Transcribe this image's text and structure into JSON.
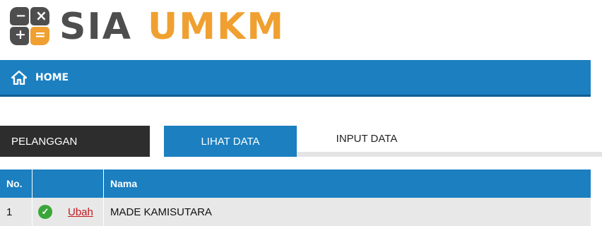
{
  "logo": {
    "text_sia": "SIA",
    "text_umkm": "UMKM",
    "colors": {
      "dark": "#4e4e4e",
      "accent": "#f0a030"
    },
    "calc_glyphs": [
      "−",
      "×",
      "+",
      "="
    ]
  },
  "nav": {
    "home_icon": "home-icon",
    "home_label": "HOME",
    "color": "#1b7fc0"
  },
  "section": {
    "title": "PELANGGAN",
    "tabs": [
      {
        "label": "LIHAT DATA",
        "active": true
      },
      {
        "label": "INPUT DATA",
        "active": false
      }
    ]
  },
  "table": {
    "headers": {
      "no": "No.",
      "action": "",
      "nama": "Nama"
    },
    "rows": [
      {
        "no": "1",
        "status_icon": "check-circle-icon",
        "action_label": "Ubah",
        "nama": "MADE KAMISUTARA"
      }
    ]
  }
}
